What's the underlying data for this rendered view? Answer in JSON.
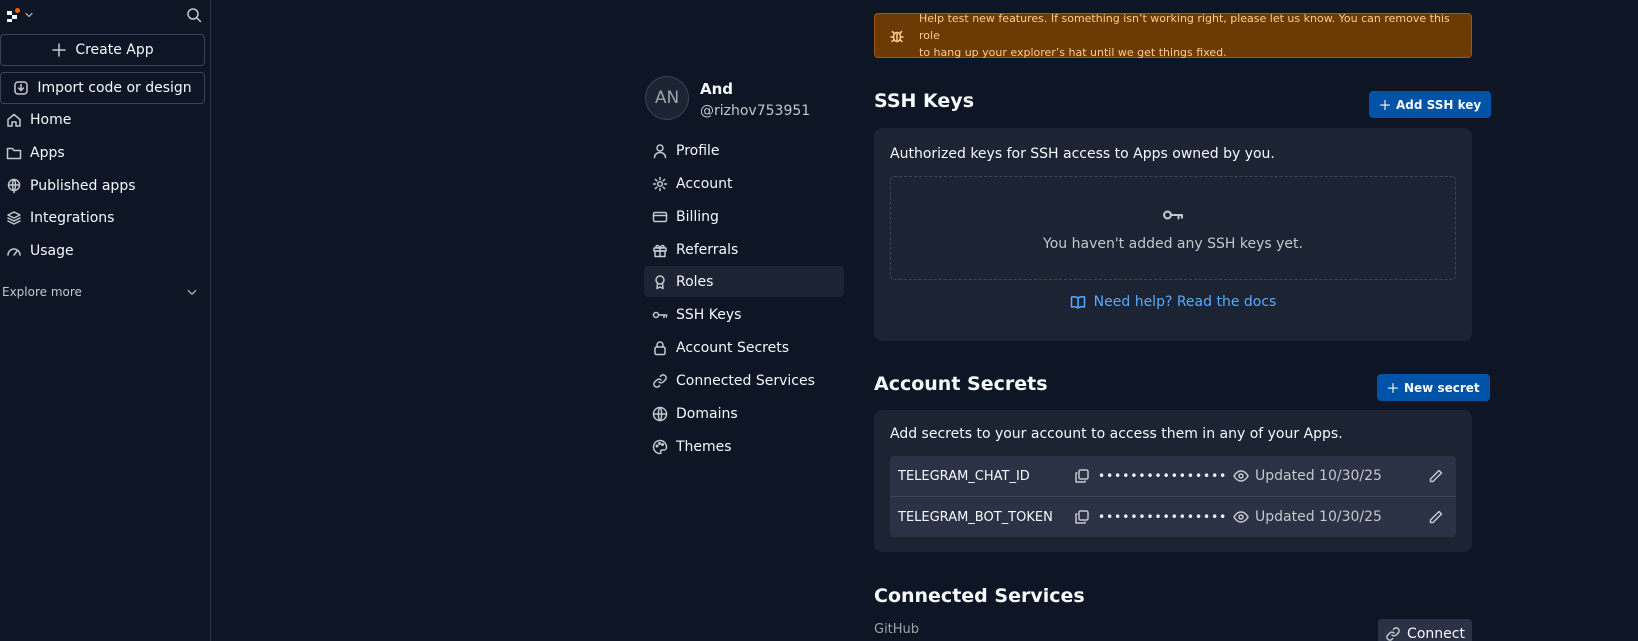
{
  "sidebar": {
    "create_label": "Create App",
    "import_label": "Import code or design",
    "items": [
      {
        "label": "Home",
        "icon": "home-icon"
      },
      {
        "label": "Apps",
        "icon": "folder-icon"
      },
      {
        "label": "Published apps",
        "icon": "globe-icon"
      },
      {
        "label": "Integrations",
        "icon": "layers-icon"
      },
      {
        "label": "Usage",
        "icon": "gauge-icon"
      }
    ],
    "explore_label": "Explore more"
  },
  "user": {
    "initials": "AN",
    "name": "And",
    "handle": "@rizhov753951"
  },
  "account_nav": [
    {
      "label": "Profile",
      "icon": "user-icon"
    },
    {
      "label": "Account",
      "icon": "gear-icon"
    },
    {
      "label": "Billing",
      "icon": "credit-card-icon"
    },
    {
      "label": "Referrals",
      "icon": "gift-icon"
    },
    {
      "label": "Roles",
      "icon": "badge-icon",
      "active": true
    },
    {
      "label": "SSH Keys",
      "icon": "key-icon"
    },
    {
      "label": "Account Secrets",
      "icon": "lock-icon"
    },
    {
      "label": "Connected Services",
      "icon": "link-icon"
    },
    {
      "label": "Domains",
      "icon": "globe-icon"
    },
    {
      "label": "Themes",
      "icon": "palette-icon"
    }
  ],
  "alert": {
    "line1": "Help test new features. If something isn’t working right, please let us know. You can remove this role",
    "line2": "to hang up your explorer’s hat until we get things fixed."
  },
  "ssh": {
    "title": "SSH Keys",
    "add_label": "Add SSH key",
    "description": "Authorized keys for SSH access to Apps owned by you.",
    "empty_text": "You haven't added any SSH keys yet.",
    "help_link": "Need help? Read the docs"
  },
  "secrets": {
    "title": "Account Secrets",
    "new_label": "New secret",
    "description": "Add secrets to your account to access them in any of your Apps.",
    "rows": [
      {
        "key": "TELEGRAM_CHAT_ID",
        "masked": "••••••••••••••••",
        "updated": "Updated 10/30/25"
      },
      {
        "key": "TELEGRAM_BOT_TOKEN",
        "masked": "••••••••••••••••",
        "updated": "Updated 10/30/25"
      }
    ]
  },
  "connected": {
    "title": "Connected Services",
    "github_label": "GitHub",
    "connect_label": "Connect"
  }
}
